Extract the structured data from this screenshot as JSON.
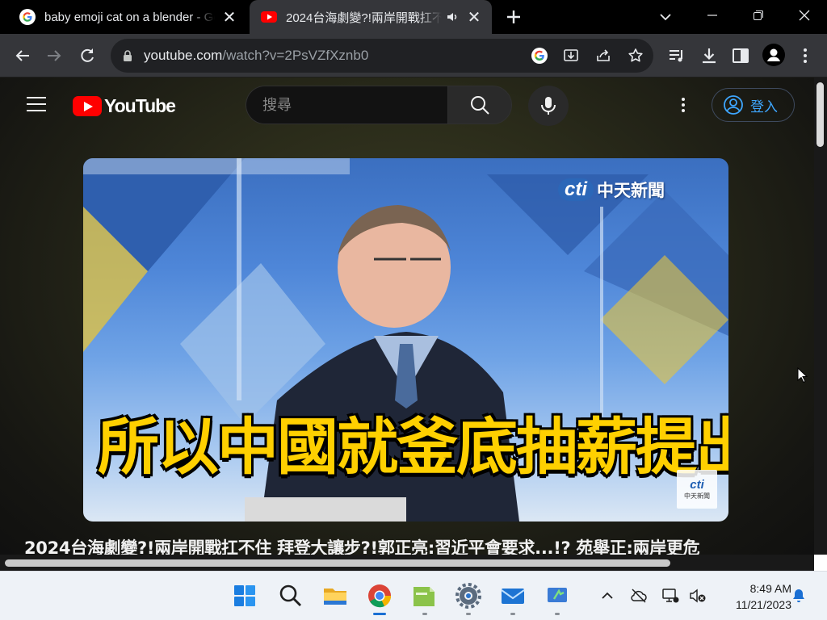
{
  "browser": {
    "tabs": [
      {
        "title": "baby emoji cat on a blender - Google",
        "favicon": "google-icon",
        "active": false
      },
      {
        "title": "2024台海劇變?!兩岸開戰扛不住 拜登大讓步",
        "favicon": "youtube-icon",
        "active": true,
        "audio": "speaker-icon"
      }
    ],
    "new_tab_label": "+",
    "close_glyph": "✕",
    "address": {
      "host": "youtube.com",
      "path": "/watch?v=2PsVZfXznb0"
    }
  },
  "youtube": {
    "logo_text": "YouTube",
    "search_placeholder": "搜尋",
    "signin_label": "登入",
    "colors": {
      "logo_red": "#ff0000",
      "signin_blue": "#3ea6ff"
    },
    "video": {
      "caption": "所以中國就釜底抽薪提出兩點",
      "channel_logo": "cti",
      "channel_name": "中天新聞",
      "corner_badge_logo": "cti",
      "corner_badge_name": "中天新聞"
    },
    "title": "2024台海劇變?!兩岸開戰扛不住 拜登大讓步?!郭正亮:習近平會要求...!? 苑舉正:兩岸更危"
  },
  "taskbar": {
    "apps": [
      "windows-start-icon",
      "search-icon",
      "file-explorer-icon",
      "chrome-icon",
      "notes-icon",
      "settings-icon",
      "mail-icon",
      "app-icon"
    ],
    "clock": {
      "time": "8:49 AM",
      "date": "11/21/2023"
    }
  }
}
